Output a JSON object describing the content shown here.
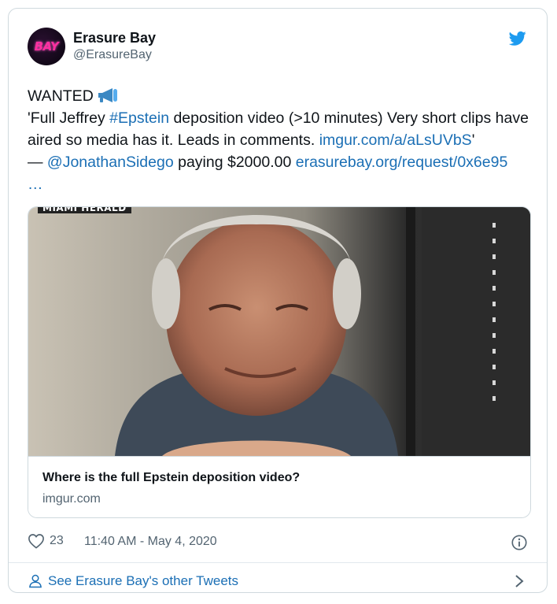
{
  "tweet": {
    "author": {
      "display_name": "Erasure Bay",
      "handle": "@ErasureBay",
      "avatar_text": "BAY"
    },
    "body": {
      "line1": "WANTED",
      "quote_open": "'Full Jeffrey ",
      "hashtag": "#Epstein",
      "text_mid": " deposition video (>10 minutes) Very short clips have aired so media has it. Leads in comments. ",
      "link_imgur": "imgur.com/a/aLsUVbS",
      "quote_close": "'",
      "dash": "— ",
      "mention": "@JonathanSidego",
      "paying_text": " paying $2000.00 ",
      "link_request": "erasurebay.org/request/0x6e95",
      "ellipsis": "…"
    },
    "card": {
      "image_badge": "MIAMI HERALD",
      "title": "Where is the full Epstein deposition video?",
      "domain": "imgur.com"
    },
    "likes": "23",
    "timestamp": "11:40 AM - May 4, 2020",
    "footer_link": "See Erasure Bay's other Tweets"
  },
  "colors": {
    "link": "#1b6fb5",
    "twitter_blue": "#1d9bf0",
    "muted": "#536471",
    "border": "#cfd9de",
    "avatar_accent": "#ff2fa0"
  },
  "icons": [
    "twitter-bird-icon",
    "megaphone-icon",
    "heart-icon",
    "info-icon",
    "person-icon",
    "chevron-right-icon"
  ]
}
